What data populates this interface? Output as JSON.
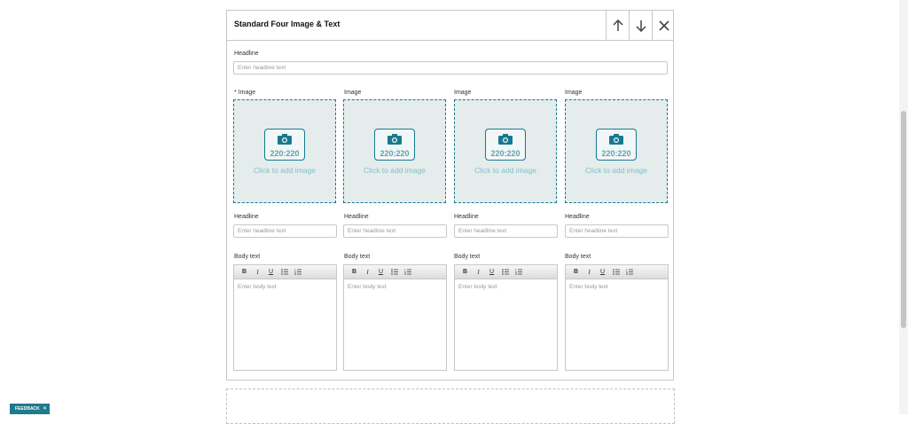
{
  "module": {
    "title": "Standard Four Image & Text",
    "headline_label": "Headline",
    "headline_placeholder": "Enter headline text",
    "columns": [
      {
        "image_label": "* Image",
        "image_size": "220:220",
        "image_cta": "Click to add image",
        "headline_label": "Headline",
        "headline_placeholder": "Enter headline text",
        "body_label": "Body text",
        "body_placeholder": "Enter body text"
      },
      {
        "image_label": "Image",
        "image_size": "220:220",
        "image_cta": "Click to add image",
        "headline_label": "Headline",
        "headline_placeholder": "Enter headline text",
        "body_label": "Body text",
        "body_placeholder": "Enter body text"
      },
      {
        "image_label": "Image",
        "image_size": "220:220",
        "image_cta": "Click to add image",
        "headline_label": "Headline",
        "headline_placeholder": "Enter headline text",
        "body_label": "Body text",
        "body_placeholder": "Enter body text"
      },
      {
        "image_label": "Image",
        "image_size": "220:220",
        "image_cta": "Click to add image",
        "headline_label": "Headline",
        "headline_placeholder": "Enter headline text",
        "body_label": "Body text",
        "body_placeholder": "Enter body text"
      }
    ],
    "toolbar": {
      "bold": "B",
      "italic": "I",
      "underline": "U"
    }
  },
  "feedback": {
    "label": "FEEDBACK",
    "close": "×"
  },
  "icons": {
    "move_up": "arrow-up-icon",
    "move_down": "arrow-down-icon",
    "remove": "close-icon",
    "camera": "camera-icon"
  },
  "colors": {
    "accent": "#157a91",
    "drop_bg": "#e4ecec",
    "feedback_bg": "#1f7a8c"
  }
}
